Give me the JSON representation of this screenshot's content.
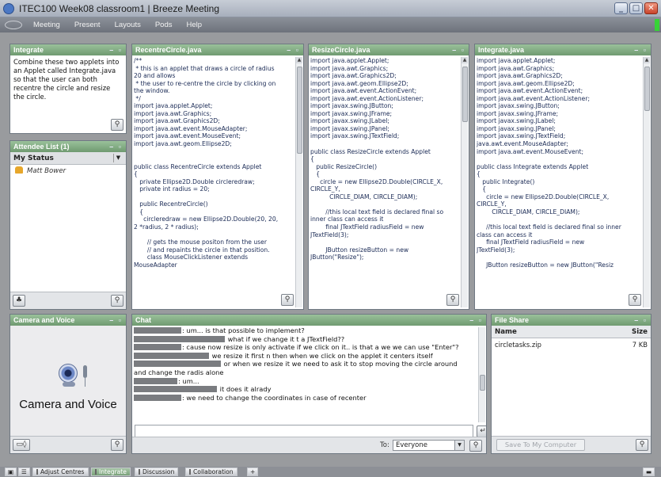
{
  "window": {
    "title": "ITEC100 Week08 classroom1 | Breeze Meeting"
  },
  "menu": [
    "Meeting",
    "Present",
    "Layouts",
    "Pods",
    "Help"
  ],
  "pods": {
    "integrate_notes": {
      "title": "Integrate",
      "text": "Combine these two applets into an Applet called Integrate.java so that the user can both recentre the circle and resize the circle."
    },
    "attendee": {
      "title": "Attendee List (1)",
      "my_status_label": "My Status",
      "attendees": [
        "Matt Bower"
      ]
    },
    "recentre": {
      "title": "RecentreCircle.java",
      "code": "/**\n * this is an applet that draws a circle of radius\n20 and allows\n * the user to re-centre the circle by clicking on\nthe window.\n */\nimport java.applet.Applet;\nimport java.awt.Graphics;\nimport java.awt.Graphics2D;\nimport java.awt.event.MouseAdapter;\nimport java.awt.event.MouseEvent;\nimport java.awt.geom.Ellipse2D;\n\n\npublic class RecentreCircle extends Applet\n{\n   private Ellipse2D.Double circleredraw;\n   private int radius = 20;\n\n   public RecentreCircle()\n   {\n     circleredraw = new Ellipse2D.Double(20, 20,\n2 *radius, 2 * radius);\n\n       // gets the mouse positon from the user\n       // and repaints the circle in that position.\n       class MouseClickListener extends\nMouseAdapter"
    },
    "resize": {
      "title": "ResizeCircle.java",
      "code": "import java.applet.Applet;\nimport java.awt.Graphics;\nimport java.awt.Graphics2D;\nimport java.awt.geom.Ellipse2D;\nimport java.awt.event.ActionEvent;\nimport java.awt.event.ActionListener;\nimport javax.swing.JButton;\nimport javax.swing.JFrame;\nimport javax.swing.JLabel;\nimport javax.swing.JPanel;\nimport javax.swing.JTextField;\n\npublic class ResizeCircle extends Applet\n{\n   public ResizeCircle()\n   {\n     circle = new Ellipse2D.Double(CIRCLE_X,\nCIRCLE_Y,\n          CIRCLE_DIAM, CIRCLE_DIAM);\n\n        //this local text field is declared final so\ninner class can access it\n        final JTextField radiusField = new\nJTextField(3);\n\n        JButton resizeButton = new\nJButton(\"Resize\");"
    },
    "integrate_code": {
      "title": "Integrate.java",
      "code": "import java.applet.Applet;\nimport java.awt.Graphics;\nimport java.awt.Graphics2D;\nimport java.awt.geom.Ellipse2D;\nimport java.awt.event.ActionEvent;\nimport java.awt.event.ActionListener;\nimport javax.swing.JButton;\nimport javax.swing.JFrame;\nimport javax.swing.JLabel;\nimport javax.swing.JPanel;\nimport javax.swing.JTextField;\njava.awt.event.MouseAdapter;\nimport java.awt.event.MouseEvent;\n\npublic class Integrate extends Applet\n{\n   public Integrate()\n   {\n     circle = new Ellipse2D.Double(CIRCLE_X,\nCIRCLE_Y,\n        CIRCLE_DIAM, CIRCLE_DIAM);\n\n     //this local text field is declared final so inner\nclass can access it\n     final JTextField radiusField = new\nJTextField(3);\n\n     JButton resizeButton = new JButton(\"Resiz"
    },
    "camera": {
      "title": "Camera and Voice",
      "label": "Camera and Voice"
    },
    "chat": {
      "title": "Chat",
      "messages": [
        {
          "redact": 60,
          "text": ": um... is that possible to implement?"
        },
        {
          "redact": 115,
          "text": " what if we change it t a JTextField??"
        },
        {
          "redact": 60,
          "text": ": cause now resize is only activate if we click on it.. is that a we we can use \"Enter\"?"
        },
        {
          "redact": 95,
          "text": " we resize it first n then when we click on the applet it centers itself"
        },
        {
          "redact": 110,
          "text": " or when we resize it we need to ask it to stop moving the circle around"
        },
        {
          "redact": 0,
          "text": "and change the radis alone"
        },
        {
          "redact": 55,
          "text": ": um..."
        },
        {
          "redact": 105,
          "text": " it does it alrady"
        },
        {
          "redact": 60,
          "text": ": we need to change the coordinates in case of recenter"
        }
      ],
      "to_label": "To:",
      "to_value": "Everyone"
    },
    "fileshare": {
      "title": "File Share",
      "name_header": "Name",
      "size_header": "Size",
      "files": [
        {
          "name": "circletasks.zip",
          "size": "7 KB"
        }
      ],
      "save_label": "Save To My Computer"
    }
  },
  "tabs": [
    "Adjust Centres",
    "Integrate",
    "Discussion",
    "Collaboration"
  ],
  "active_tab": "Integrate"
}
